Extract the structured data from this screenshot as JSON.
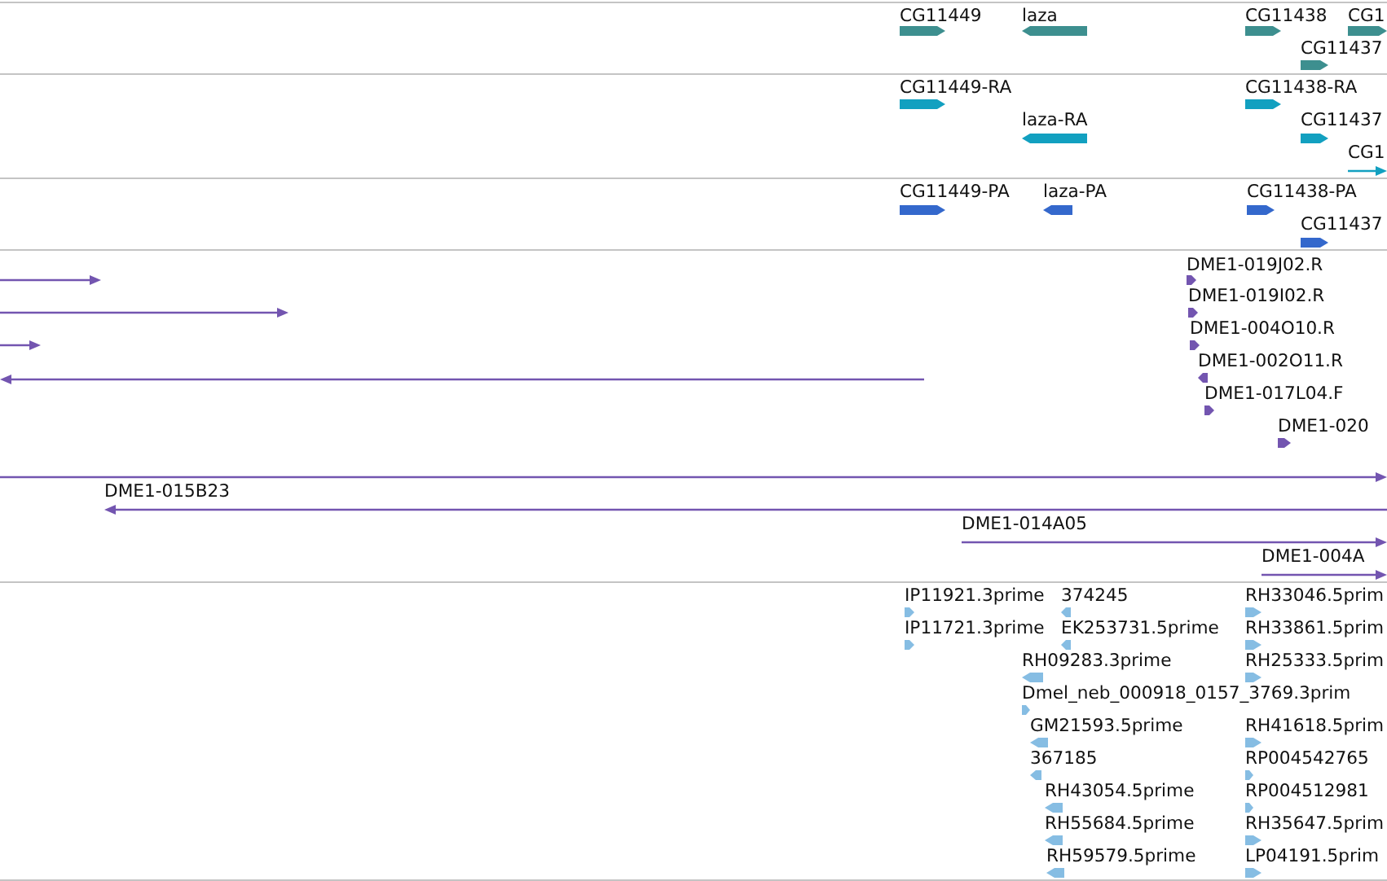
{
  "tracks": [
    {
      "color": "#3d8f8f",
      "features": [
        {
          "label": "CG11449",
          "reverse": false,
          "kind": "block"
        },
        {
          "label": "laza",
          "reverse": true,
          "kind": "block"
        },
        {
          "label": "CG11438",
          "reverse": false,
          "kind": "block"
        },
        {
          "label": "CG1",
          "reverse": false,
          "kind": "block"
        },
        {
          "label": "CG11437",
          "reverse": false,
          "kind": "block"
        }
      ]
    },
    {
      "color": "#12a0c0",
      "features": [
        {
          "label": "CG11449-RA",
          "reverse": false,
          "kind": "block"
        },
        {
          "label": "laza-RA",
          "reverse": true,
          "kind": "block"
        },
        {
          "label": "CG11438-RA",
          "reverse": false,
          "kind": "block"
        },
        {
          "label": "CG11437",
          "reverse": false,
          "kind": "block"
        },
        {
          "label": "CG1",
          "reverse": false,
          "kind": "line"
        }
      ]
    },
    {
      "color": "#3468cc",
      "features": [
        {
          "label": "CG11449-PA",
          "reverse": false,
          "kind": "block"
        },
        {
          "label": "laza-PA",
          "reverse": true,
          "kind": "block"
        },
        {
          "label": "CG11438-PA",
          "reverse": false,
          "kind": "block"
        },
        {
          "label": "CG11437",
          "reverse": false,
          "kind": "block"
        }
      ]
    },
    {
      "color": "#7355b0",
      "features": [
        {
          "reverse": false,
          "kind": "line"
        },
        {
          "reverse": false,
          "kind": "line"
        },
        {
          "reverse": false,
          "kind": "line"
        },
        {
          "reverse": true,
          "kind": "line"
        },
        {
          "label": "DME1-019J02.R",
          "reverse": false,
          "kind": "block"
        },
        {
          "label": "DME1-019I02.R",
          "reverse": false,
          "kind": "block"
        },
        {
          "label": "DME1-004O10.R",
          "reverse": false,
          "kind": "block"
        },
        {
          "label": "DME1-002O11.R",
          "reverse": true,
          "kind": "block"
        },
        {
          "label": "DME1-017L04.F",
          "reverse": false,
          "kind": "block"
        },
        {
          "label": "DME1-020",
          "reverse": false,
          "kind": "block"
        },
        {
          "reverse": false,
          "kind": "line"
        },
        {
          "label": "DME1-015B23",
          "reverse": true,
          "kind": "line"
        },
        {
          "label": "DME1-014A05",
          "reverse": false,
          "kind": "line"
        },
        {
          "label": "DME1-004A",
          "reverse": false,
          "kind": "line"
        }
      ]
    },
    {
      "color": "#86bde3",
      "features": [
        {
          "label": "IP11921.3prime",
          "reverse": false,
          "kind": "block"
        },
        {
          "label": "IP11721.3prime",
          "reverse": false,
          "kind": "block"
        },
        {
          "label": "374245",
          "reverse": true,
          "kind": "block"
        },
        {
          "label": "EK253731.5prime",
          "reverse": true,
          "kind": "block"
        },
        {
          "label": "RH09283.3prime",
          "reverse": true,
          "kind": "block"
        },
        {
          "label": "Dmel_neb_000918_0157_3769.3prim",
          "reverse": false,
          "kind": "block"
        },
        {
          "label": "GM21593.5prime",
          "reverse": true,
          "kind": "block"
        },
        {
          "label": "367185",
          "reverse": true,
          "kind": "block"
        },
        {
          "label": "RH43054.5prime",
          "reverse": true,
          "kind": "block"
        },
        {
          "label": "RH55684.5prime",
          "reverse": true,
          "kind": "block"
        },
        {
          "label": "RH59579.5prime",
          "reverse": true,
          "kind": "block"
        },
        {
          "label": "RH33046.5prim",
          "reverse": false,
          "kind": "block"
        },
        {
          "label": "RH33861.5prim",
          "reverse": false,
          "kind": "block"
        },
        {
          "label": "RH25333.5prim",
          "reverse": false,
          "kind": "block"
        },
        {
          "label": "RH41618.5prim",
          "reverse": false,
          "kind": "block"
        },
        {
          "label": "RP004542765",
          "reverse": false,
          "kind": "block"
        },
        {
          "label": "RP004512981",
          "reverse": false,
          "kind": "block"
        },
        {
          "label": "RH35647.5prim",
          "reverse": false,
          "kind": "block"
        },
        {
          "label": "LP04191.5prim",
          "reverse": false,
          "kind": "block"
        }
      ]
    }
  ]
}
